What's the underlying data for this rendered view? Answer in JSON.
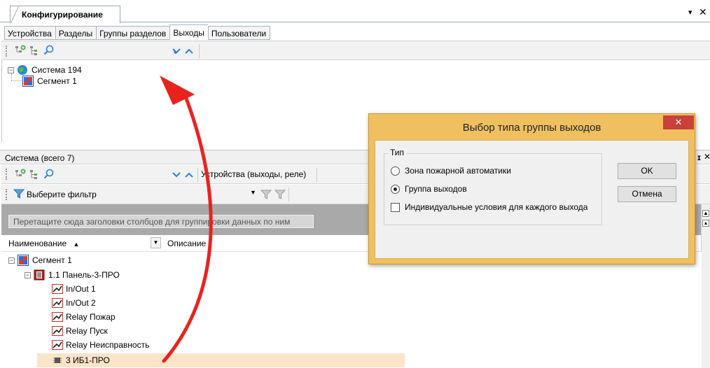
{
  "document_tab": {
    "title": "Конфигурирование",
    "pin_glyph": "▾",
    "close_glyph": "✕"
  },
  "tabs": [
    {
      "label": "Устройства",
      "active": false
    },
    {
      "label": "Разделы",
      "active": false
    },
    {
      "label": "Группы разделов",
      "active": false
    },
    {
      "label": "Выходы",
      "active": true
    },
    {
      "label": "Пользователи",
      "active": false
    }
  ],
  "top_tree": {
    "items": [
      {
        "label": "Система 194",
        "icon": "globe-icon",
        "expander": "−"
      },
      {
        "label": "Сегмент 1",
        "icon": "segment-icon"
      }
    ]
  },
  "system_panel": {
    "title": "Система (всего 7)",
    "devices_dropdown": "Устройства (выходы, реле)",
    "filter_label": "Выберите фильтр",
    "group_hint": "Перетащите сюда заголовки столбцов для группировки данных по ним",
    "columns": {
      "name": "Наименование",
      "sort_glyph": "▲",
      "description": "Описание"
    },
    "tree": [
      {
        "label": "Сегмент 1",
        "icon": "segment-icon",
        "level": 0,
        "expander": "−"
      },
      {
        "label": "1.1 Панель-3-ПРО",
        "icon": "panel-icon",
        "level": 1,
        "expander": "−"
      },
      {
        "label": "In/Out 1",
        "icon": "relay-icon",
        "level": 2
      },
      {
        "label": "In/Out 2",
        "icon": "relay-icon",
        "level": 2
      },
      {
        "label": "Relay Пожар",
        "icon": "relay-icon",
        "level": 2
      },
      {
        "label": "Relay Пуск",
        "icon": "relay-icon",
        "level": 2
      },
      {
        "label": "Relay Неисправность",
        "icon": "relay-icon",
        "level": 2
      },
      {
        "label": "3 ИБ1-ПРО",
        "icon": "module-icon",
        "level": 2,
        "selected": true
      }
    ]
  },
  "dialog": {
    "title": "Выбор типа группы выходов",
    "close_glyph": "✕",
    "group_label": "Тип",
    "options": [
      {
        "label": "Зона пожарной автоматики",
        "checked": false
      },
      {
        "label": "Группа выходов",
        "checked": true
      }
    ],
    "checkbox_label": "Индивидуальные условия для каждого выхода",
    "checkbox_checked": false,
    "ok_label": "OK",
    "cancel_label": "Отмена"
  },
  "colors": {
    "dialog_frame": "#f0c060",
    "dialog_close": "#c8413a",
    "selection": "#fbe4c8",
    "annotation_arrow": "#e8231f",
    "accent_chevron": "#2f7ed8"
  }
}
